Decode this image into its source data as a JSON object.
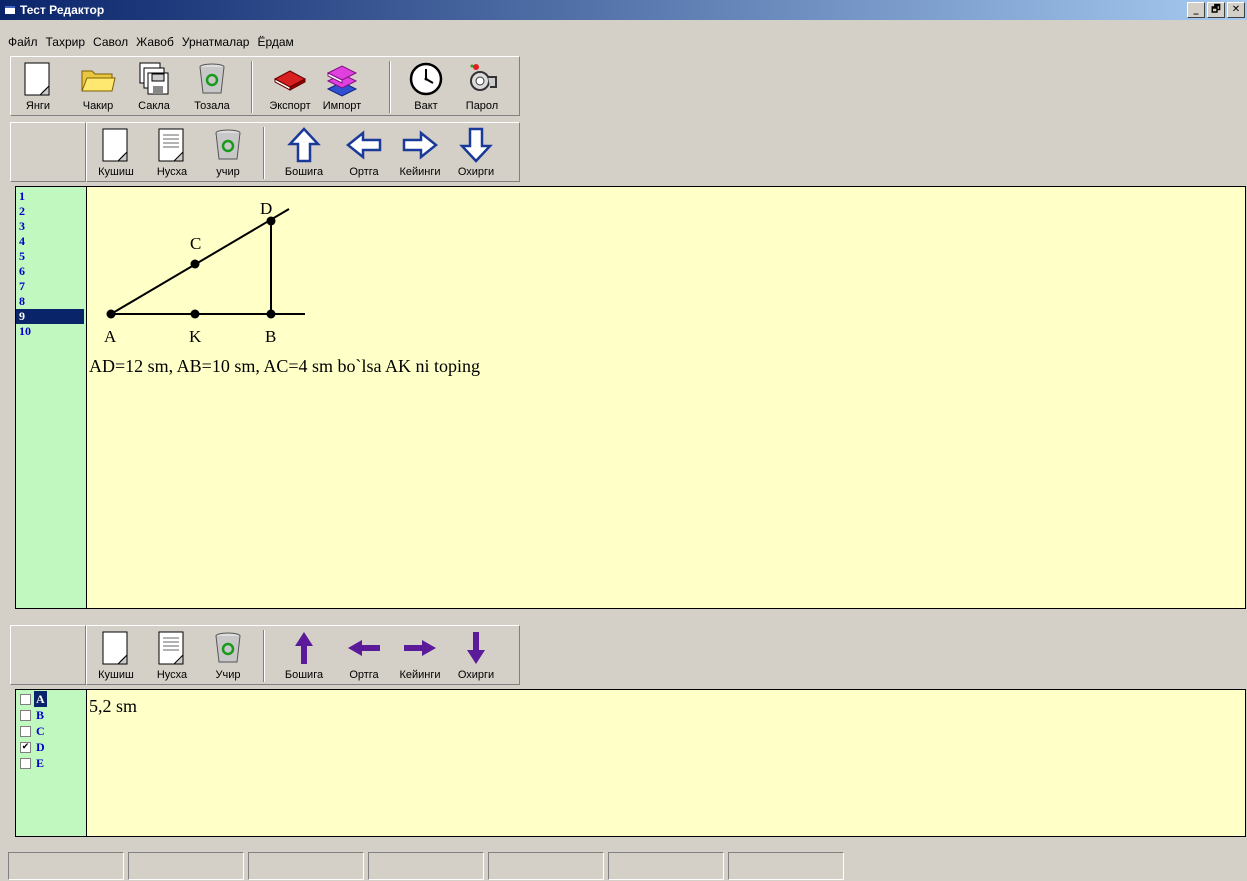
{
  "window": {
    "title": "Тест Редактор",
    "controls": [
      "_",
      "🗗",
      "✕"
    ]
  },
  "menu": [
    "Файл",
    "Тахрир",
    "Савол",
    "Жавоб",
    "Урнатмалар",
    "Ёрдам"
  ],
  "toolbar1": [
    {
      "label": "Янги",
      "icon": "new-doc-icon"
    },
    {
      "label": "Чакир",
      "icon": "folder-open-icon"
    },
    {
      "label": "Сакла",
      "icon": "save-disks-icon"
    },
    {
      "label": "Тозала",
      "icon": "recycle-bin-icon"
    },
    {
      "label": "Экспорт",
      "icon": "book-red-icon"
    },
    {
      "label": "Импорт",
      "icon": "books-stack-icon"
    },
    {
      "label": "Вакт",
      "icon": "clock-icon"
    },
    {
      "label": "Парол",
      "icon": "key-icon"
    }
  ],
  "toolbar2": [
    {
      "label": "Кушиш",
      "icon": "new-doc-icon"
    },
    {
      "label": "Нусха",
      "icon": "copy-doc-icon"
    },
    {
      "label": "учир",
      "icon": "recycle-bin-icon"
    },
    {
      "label": "Бошига",
      "icon": "arrow-up-outline-icon"
    },
    {
      "label": "Ортга",
      "icon": "arrow-left-outline-icon"
    },
    {
      "label": "Кейинги",
      "icon": "arrow-right-outline-icon"
    },
    {
      "label": "Охирги",
      "icon": "arrow-down-outline-icon"
    }
  ],
  "toolbar3": [
    {
      "label": "Кушиш",
      "icon": "new-doc-icon"
    },
    {
      "label": "Нусха",
      "icon": "copy-doc-icon"
    },
    {
      "label": "Учир",
      "icon": "recycle-bin-icon"
    },
    {
      "label": "Бошига",
      "icon": "arrow-up-solid-icon"
    },
    {
      "label": "Ортга",
      "icon": "arrow-left-solid-icon"
    },
    {
      "label": "Кейинги",
      "icon": "arrow-right-solid-icon"
    },
    {
      "label": "Охирги",
      "icon": "arrow-down-solid-icon"
    }
  ],
  "questions": {
    "items": [
      "1",
      "2",
      "3",
      "4",
      "5",
      "6",
      "7",
      "8",
      "9",
      "10"
    ],
    "selected": "9"
  },
  "question": {
    "points": [
      "A",
      "K",
      "B",
      "C",
      "D"
    ],
    "text": "AD=12 sm, AB=10 sm, AC=4 sm bo`lsa AK ni toping"
  },
  "options": {
    "items": [
      {
        "label": "A",
        "checked": false,
        "selected": true
      },
      {
        "label": "B",
        "checked": false,
        "selected": false
      },
      {
        "label": "C",
        "checked": false,
        "selected": false
      },
      {
        "label": "D",
        "checked": true,
        "selected": false
      },
      {
        "label": "E",
        "checked": false,
        "selected": false
      }
    ]
  },
  "answer": {
    "text": "5,2 sm"
  }
}
